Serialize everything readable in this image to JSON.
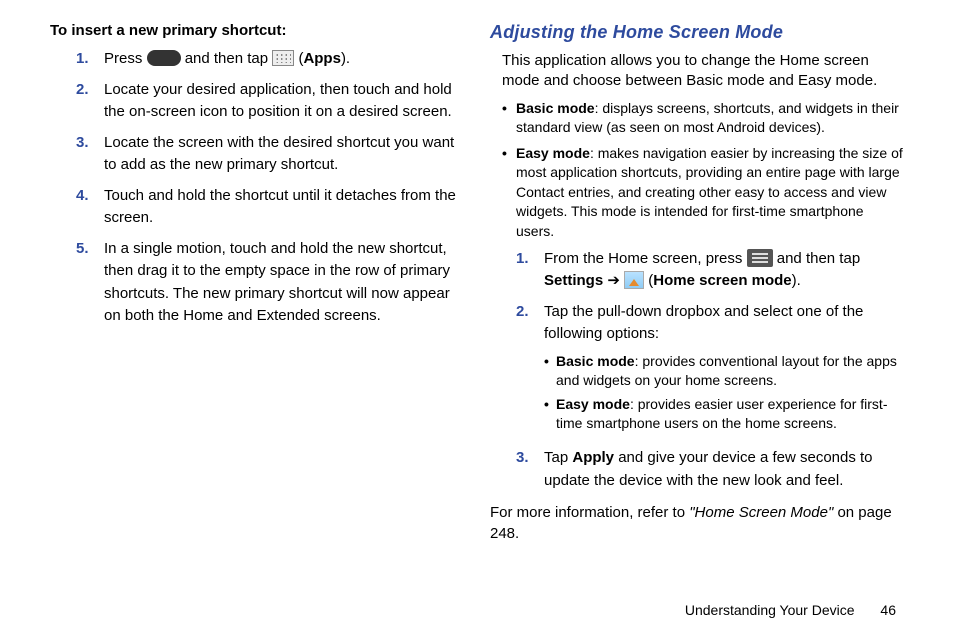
{
  "left": {
    "heading": "To insert a new primary shortcut:",
    "steps": [
      {
        "n": "1.",
        "pre": "Press ",
        "mid": " and then tap ",
        "post1": " (",
        "apps": "Apps",
        "post2": ")."
      },
      {
        "n": "2.",
        "text": "Locate your desired application, then touch and hold the on-screen icon to position it on a desired screen."
      },
      {
        "n": "3.",
        "text": "Locate the screen with the desired shortcut you want to add as the new primary shortcut."
      },
      {
        "n": "4.",
        "text": "Touch and hold the shortcut until it detaches from the screen."
      },
      {
        "n": "5.",
        "text": "In a single motion, touch and hold the new shortcut, then drag it to the empty space in the row of primary shortcuts. The new primary shortcut will now appear on both the Home and Extended screens."
      }
    ]
  },
  "right": {
    "heading": "Adjusting the Home Screen Mode",
    "intro": "This application allows you to change the Home screen mode and choose between Basic mode and Easy mode.",
    "bullets": [
      {
        "label": "Basic mode",
        "text": ": displays screens, shortcuts, and widgets in their standard view (as seen on most Android devices)."
      },
      {
        "label": "Easy mode",
        "text": ": makes navigation easier by increasing the size of most application shortcuts, providing an entire page with large Contact entries, and creating other easy to access and view widgets. This mode is intended for first-time smartphone users."
      }
    ],
    "steps": [
      {
        "n": "1.",
        "pre": "From the Home screen, press ",
        "mid": " and then tap ",
        "settings": "Settings",
        "arrow": " ➔ ",
        "post1": " (",
        "hsm": "Home screen mode",
        "post2": ")."
      },
      {
        "n": "2.",
        "text": "Tap the pull-down dropbox and select one of the following options:",
        "sub": [
          {
            "label": "Basic mode",
            "text": ": provides conventional layout for the apps and widgets on your home screens."
          },
          {
            "label": "Easy mode",
            "text": ": provides easier user experience for first-time smartphone users on the home screens."
          }
        ]
      },
      {
        "n": "3.",
        "pre": "Tap ",
        "apply": "Apply",
        "post": " and give your device a few seconds to update the device with the new look and feel."
      }
    ],
    "for_more_pre": "For more information, refer to ",
    "for_more_ref": "\"Home Screen Mode\"",
    "for_more_post": "  on page 248."
  },
  "footer": {
    "section": "Understanding Your Device",
    "page": "46"
  }
}
